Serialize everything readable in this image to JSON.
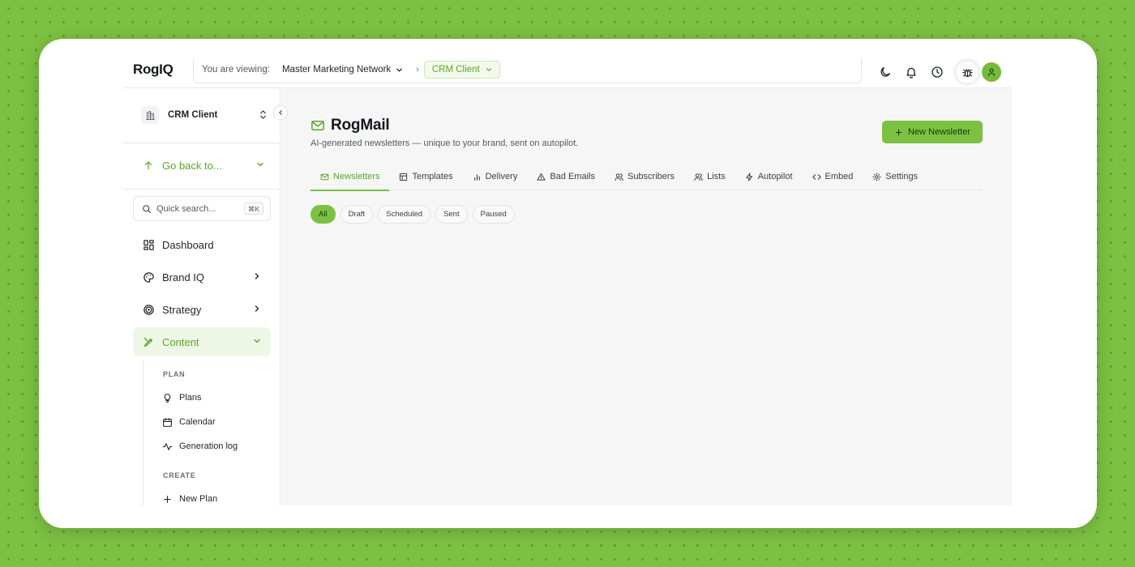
{
  "colors": {
    "accent": "#7cc142",
    "accent_text": "#5aa823",
    "background": "#7cc142"
  },
  "header": {
    "logo": "RogIQ",
    "context_label": "You are viewing:",
    "network": "Master Marketing Network",
    "separator": "›",
    "client": "CRM Client",
    "icons": [
      "moon-icon",
      "bell-icon",
      "clock-icon",
      "bug-icon",
      "user-avatar-icon"
    ]
  },
  "sidebar": {
    "workspace": "CRM Client",
    "go_back": "Go back to...",
    "search": {
      "placeholder": "Quick search...",
      "shortcut": "⌘K"
    },
    "nav": [
      {
        "label": "Dashboard",
        "icon": "dashboard-icon"
      },
      {
        "label": "Brand IQ",
        "icon": "palette-icon"
      },
      {
        "label": "Strategy",
        "icon": "target-icon"
      },
      {
        "label": "Content",
        "icon": "pen-icon",
        "active": true
      }
    ],
    "content_sections": {
      "plan_label": "PLAN",
      "plan_items": [
        {
          "label": "Plans",
          "icon": "lightbulb-icon"
        },
        {
          "label": "Calendar",
          "icon": "calendar-icon"
        },
        {
          "label": "Generation log",
          "icon": "activity-icon"
        }
      ],
      "create_label": "CREATE",
      "create_items": [
        {
          "label": "New Plan",
          "icon": "plus-icon"
        }
      ]
    }
  },
  "main": {
    "title": "RogMail",
    "subtitle": "AI-generated newsletters — unique to your brand, sent on autopilot.",
    "new_button": "New Newsletter",
    "tabs": [
      {
        "label": "Newsletters",
        "icon": "mail-icon",
        "active": true
      },
      {
        "label": "Templates",
        "icon": "template-icon"
      },
      {
        "label": "Delivery",
        "icon": "bar-chart-icon"
      },
      {
        "label": "Bad Emails",
        "icon": "warning-icon"
      },
      {
        "label": "Subscribers",
        "icon": "users-icon"
      },
      {
        "label": "Lists",
        "icon": "users-icon"
      },
      {
        "label": "Autopilot",
        "icon": "zap-icon"
      },
      {
        "label": "Embed",
        "icon": "code-icon"
      },
      {
        "label": "Settings",
        "icon": "gear-icon"
      }
    ],
    "filters": [
      {
        "label": "All",
        "active": true
      },
      {
        "label": "Draft"
      },
      {
        "label": "Scheduled"
      },
      {
        "label": "Sent"
      },
      {
        "label": "Paused"
      }
    ]
  }
}
